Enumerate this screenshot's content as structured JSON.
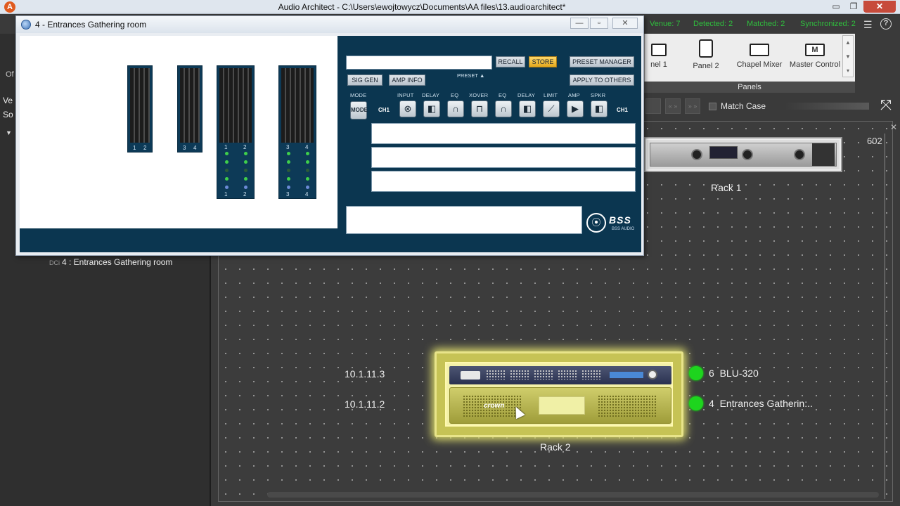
{
  "app": {
    "title": "Audio Architect - C:\\Users\\ewojtowycz\\Documents\\AA files\\13.audioarchitect*",
    "icon": "app-logo-icon",
    "window_controls": {
      "minimize": "▭",
      "maximize": "❐",
      "close": "✕"
    }
  },
  "status": {
    "venue": "Venue: 7",
    "detected": "Detected: 2",
    "matched": "Matched: 2",
    "synchronized": "Synchronized: 2",
    "color": "#2fbf3d"
  },
  "ribbon": {
    "items": [
      {
        "label": "nel 1",
        "icon": "panel-icon"
      },
      {
        "label": "Panel 2",
        "icon": "panel-icon"
      },
      {
        "label": "Chapel Mixer",
        "icon": "panel-icon"
      },
      {
        "label": "Master Control",
        "icon": "panel-icon"
      }
    ],
    "group_label": "Panels"
  },
  "search": {
    "match_case_label": "Match Case",
    "match_case_checked": false
  },
  "sidebar": {
    "fragment_of": "Of",
    "fragment_ver": "Ve",
    "fragment_sor": "So",
    "tree_item_prefix": "DCi",
    "tree_item_label": "4 : Entrances  Gathering room"
  },
  "device_window": {
    "title": "4 - Entrances  Gathering room",
    "meters": [
      {
        "labels": [
          "1",
          "2"
        ]
      },
      {
        "labels": [
          "3",
          "4"
        ]
      },
      {
        "labels_top": [
          "1",
          "2"
        ],
        "labels_bottom": [
          "1",
          "2"
        ]
      },
      {
        "labels_top": [
          "3",
          "4"
        ],
        "labels_bottom": [
          "3",
          "4"
        ]
      }
    ],
    "buttons": {
      "recall": "RECALL",
      "store": "STORE",
      "preset_manager": "PRESET MANAGER",
      "sig_gen": "SIG GEN",
      "amp_info": "AMP INFO",
      "apply_to_others": "APPLY TO OTHERS",
      "preset_arrow": "PRESET ▲",
      "mode": "MODE"
    },
    "chain_labels": [
      "MODE",
      "INPUT",
      "DELAY",
      "EQ",
      "XOVER",
      "EQ",
      "DELAY",
      "LIMIT",
      "AMP",
      "SPKR"
    ],
    "channel_label_left": "CH1",
    "channel_label_right": "CH1",
    "brand": "BSS",
    "brand_sub": "BSS AUDIO",
    "store_color": "#e4a81c"
  },
  "canvas": {
    "number_tag": "602",
    "rack1_label": "Rack 1",
    "rack2_label": "Rack 2",
    "ip_1": "10.1.11.3",
    "ip_2": "10.1.11.2",
    "device_1": {
      "number": "6",
      "name": "BLU-320",
      "status_color": "#1ed41e"
    },
    "device_2": {
      "number": "4",
      "name": "Entrances  Gatherin:..",
      "status_color": "#1ed41e"
    },
    "amp_brand": "crown",
    "highlight_color": "#c6c355"
  }
}
